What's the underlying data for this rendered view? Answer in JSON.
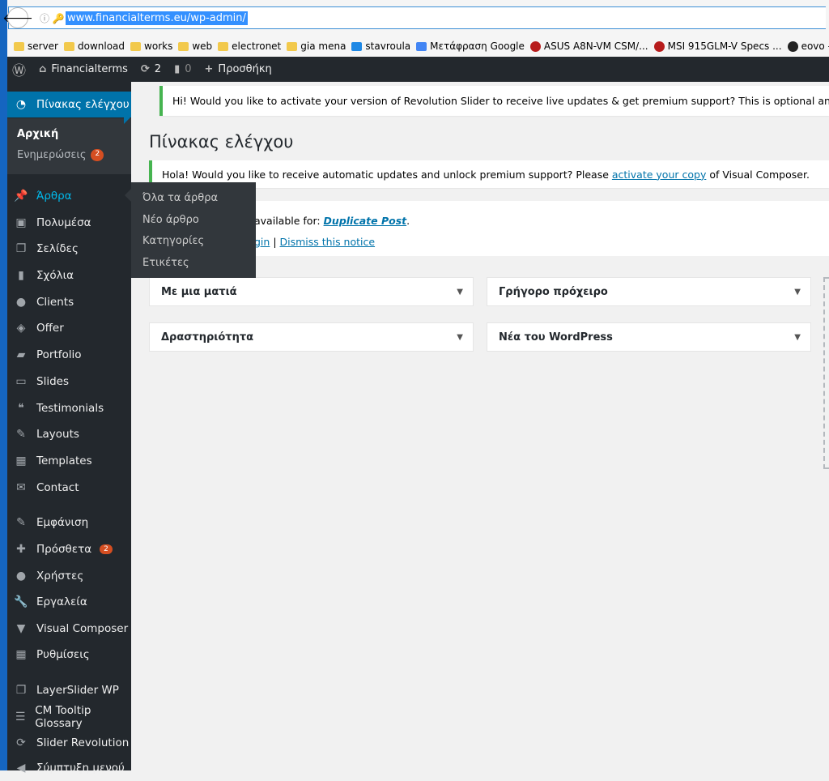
{
  "browser": {
    "url": "www.financialterms.eu/wp-admin/",
    "bookmarks": [
      "server",
      "download",
      "works",
      "web",
      "electronet",
      "gia mena",
      "stavroula",
      "Μετάφραση Google",
      "ASUS A8N-VM CSM/...",
      "MSI 915GLM-V Specs ...",
      "eovo – Just anot"
    ]
  },
  "adminbar": {
    "site": "Financialterms",
    "updates": "2",
    "comments": "0",
    "new": "Προσθήκη"
  },
  "sidebar": {
    "dashboard": "Πίνακας ελέγχου",
    "home": "Αρχική",
    "updates": "Ενημερώσεις",
    "updates_count": "2",
    "items": [
      "Άρθρα",
      "Πολυμέσα",
      "Σελίδες",
      "Σχόλια",
      "Clients",
      "Offer",
      "Portfolio",
      "Slides",
      "Testimonials",
      "Layouts",
      "Templates",
      "Contact",
      "Εμφάνιση",
      "Πρόσθετα",
      "Χρήστες",
      "Εργαλεία",
      "Visual Composer",
      "Ρυθμίσεις",
      "LayerSlider WP",
      "CM Tooltip Glossary",
      "Slider Revolution",
      "Σύμπτυξη μενού"
    ],
    "plugins_count": "2",
    "flyout": [
      "Όλα τα άρθρα",
      "Νέο άρθρο",
      "Κατηγορίες",
      "Ετικέτες"
    ]
  },
  "notices": {
    "revslider": "Hi! Would you like to activate your version of Revolution Slider to receive live updates & get premium support? This is optional and not needed if the slider came bundled with a theme.",
    "vc_pre": "Hola! Would you like to receive automatic updates and unlock premium support? Please ",
    "vc_link": "activate your copy",
    "vc_post": " of Visual Composer.",
    "dup_pre": "available for: ",
    "dup_link": "Duplicate Post",
    "dup_gin": "gin",
    "dup_sep": " | ",
    "dup_dismiss": "Dismiss this notice"
  },
  "page_title": "Πίνακας ελέγχου",
  "widgets": [
    "Με μια ματιά",
    "Γρήγορο πρόχειρο",
    "Δραστηριότητα",
    "Νέα του WordPress"
  ]
}
